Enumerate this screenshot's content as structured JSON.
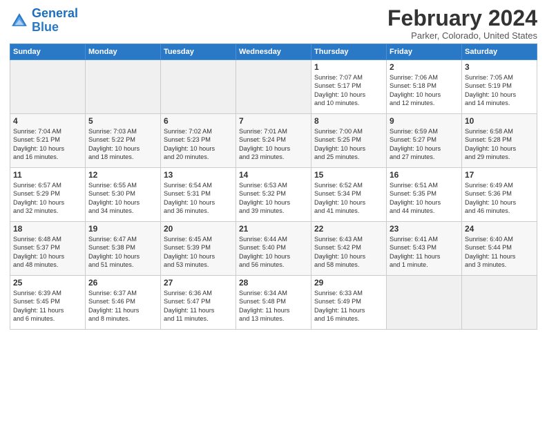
{
  "header": {
    "logo_general": "General",
    "logo_blue": "Blue",
    "title": "February 2024",
    "location": "Parker, Colorado, United States"
  },
  "weekdays": [
    "Sunday",
    "Monday",
    "Tuesday",
    "Wednesday",
    "Thursday",
    "Friday",
    "Saturday"
  ],
  "weeks": [
    [
      {
        "day": "",
        "info": ""
      },
      {
        "day": "",
        "info": ""
      },
      {
        "day": "",
        "info": ""
      },
      {
        "day": "",
        "info": ""
      },
      {
        "day": "1",
        "info": "Sunrise: 7:07 AM\nSunset: 5:17 PM\nDaylight: 10 hours\nand 10 minutes."
      },
      {
        "day": "2",
        "info": "Sunrise: 7:06 AM\nSunset: 5:18 PM\nDaylight: 10 hours\nand 12 minutes."
      },
      {
        "day": "3",
        "info": "Sunrise: 7:05 AM\nSunset: 5:19 PM\nDaylight: 10 hours\nand 14 minutes."
      }
    ],
    [
      {
        "day": "4",
        "info": "Sunrise: 7:04 AM\nSunset: 5:21 PM\nDaylight: 10 hours\nand 16 minutes."
      },
      {
        "day": "5",
        "info": "Sunrise: 7:03 AM\nSunset: 5:22 PM\nDaylight: 10 hours\nand 18 minutes."
      },
      {
        "day": "6",
        "info": "Sunrise: 7:02 AM\nSunset: 5:23 PM\nDaylight: 10 hours\nand 20 minutes."
      },
      {
        "day": "7",
        "info": "Sunrise: 7:01 AM\nSunset: 5:24 PM\nDaylight: 10 hours\nand 23 minutes."
      },
      {
        "day": "8",
        "info": "Sunrise: 7:00 AM\nSunset: 5:25 PM\nDaylight: 10 hours\nand 25 minutes."
      },
      {
        "day": "9",
        "info": "Sunrise: 6:59 AM\nSunset: 5:27 PM\nDaylight: 10 hours\nand 27 minutes."
      },
      {
        "day": "10",
        "info": "Sunrise: 6:58 AM\nSunset: 5:28 PM\nDaylight: 10 hours\nand 29 minutes."
      }
    ],
    [
      {
        "day": "11",
        "info": "Sunrise: 6:57 AM\nSunset: 5:29 PM\nDaylight: 10 hours\nand 32 minutes."
      },
      {
        "day": "12",
        "info": "Sunrise: 6:55 AM\nSunset: 5:30 PM\nDaylight: 10 hours\nand 34 minutes."
      },
      {
        "day": "13",
        "info": "Sunrise: 6:54 AM\nSunset: 5:31 PM\nDaylight: 10 hours\nand 36 minutes."
      },
      {
        "day": "14",
        "info": "Sunrise: 6:53 AM\nSunset: 5:32 PM\nDaylight: 10 hours\nand 39 minutes."
      },
      {
        "day": "15",
        "info": "Sunrise: 6:52 AM\nSunset: 5:34 PM\nDaylight: 10 hours\nand 41 minutes."
      },
      {
        "day": "16",
        "info": "Sunrise: 6:51 AM\nSunset: 5:35 PM\nDaylight: 10 hours\nand 44 minutes."
      },
      {
        "day": "17",
        "info": "Sunrise: 6:49 AM\nSunset: 5:36 PM\nDaylight: 10 hours\nand 46 minutes."
      }
    ],
    [
      {
        "day": "18",
        "info": "Sunrise: 6:48 AM\nSunset: 5:37 PM\nDaylight: 10 hours\nand 48 minutes."
      },
      {
        "day": "19",
        "info": "Sunrise: 6:47 AM\nSunset: 5:38 PM\nDaylight: 10 hours\nand 51 minutes."
      },
      {
        "day": "20",
        "info": "Sunrise: 6:45 AM\nSunset: 5:39 PM\nDaylight: 10 hours\nand 53 minutes."
      },
      {
        "day": "21",
        "info": "Sunrise: 6:44 AM\nSunset: 5:40 PM\nDaylight: 10 hours\nand 56 minutes."
      },
      {
        "day": "22",
        "info": "Sunrise: 6:43 AM\nSunset: 5:42 PM\nDaylight: 10 hours\nand 58 minutes."
      },
      {
        "day": "23",
        "info": "Sunrise: 6:41 AM\nSunset: 5:43 PM\nDaylight: 11 hours\nand 1 minute."
      },
      {
        "day": "24",
        "info": "Sunrise: 6:40 AM\nSunset: 5:44 PM\nDaylight: 11 hours\nand 3 minutes."
      }
    ],
    [
      {
        "day": "25",
        "info": "Sunrise: 6:39 AM\nSunset: 5:45 PM\nDaylight: 11 hours\nand 6 minutes."
      },
      {
        "day": "26",
        "info": "Sunrise: 6:37 AM\nSunset: 5:46 PM\nDaylight: 11 hours\nand 8 minutes."
      },
      {
        "day": "27",
        "info": "Sunrise: 6:36 AM\nSunset: 5:47 PM\nDaylight: 11 hours\nand 11 minutes."
      },
      {
        "day": "28",
        "info": "Sunrise: 6:34 AM\nSunset: 5:48 PM\nDaylight: 11 hours\nand 13 minutes."
      },
      {
        "day": "29",
        "info": "Sunrise: 6:33 AM\nSunset: 5:49 PM\nDaylight: 11 hours\nand 16 minutes."
      },
      {
        "day": "",
        "info": ""
      },
      {
        "day": "",
        "info": ""
      }
    ]
  ]
}
